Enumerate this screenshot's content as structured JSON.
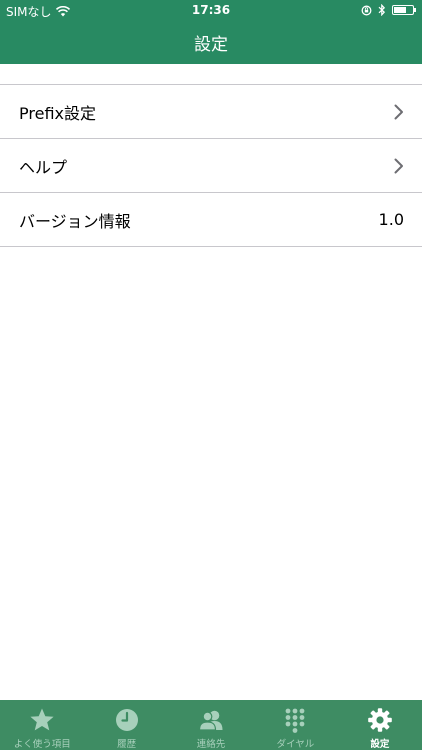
{
  "status_bar": {
    "carrier": "SIMなし",
    "time": "17:36"
  },
  "nav": {
    "title": "設定"
  },
  "settings": {
    "items": [
      {
        "label": "Prefix設定",
        "icon": "chevron-right-icon"
      },
      {
        "label": "ヘルプ",
        "icon": "chevron-right-icon"
      },
      {
        "label": "バージョン情報",
        "value": "1.0"
      }
    ]
  },
  "tab_bar": {
    "active_color": "#ffffff",
    "inactive_color": "#a7d0bb",
    "tabs": [
      {
        "label": "よく使う項目",
        "icon": "star-icon"
      },
      {
        "label": "履歴",
        "icon": "clock-icon"
      },
      {
        "label": "連絡先",
        "icon": "contacts-icon"
      },
      {
        "label": "ダイヤル",
        "icon": "keypad-icon"
      },
      {
        "label": "設定",
        "icon": "gear-icon",
        "active": true
      }
    ]
  }
}
